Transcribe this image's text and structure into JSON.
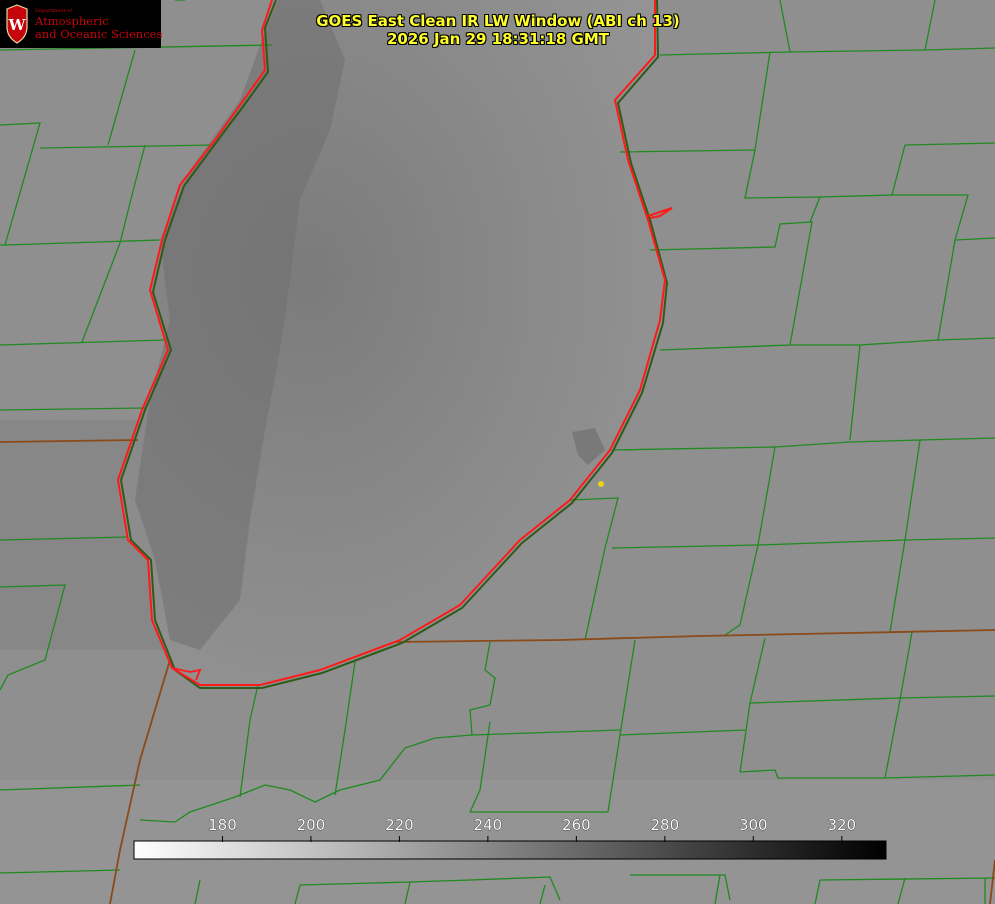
{
  "header": {
    "title": "GOES East Clean IR LW Window (ABI ch 13)",
    "timestamp": "2026 Jan 29 18:31:18 GMT"
  },
  "logo": {
    "crest_letter": "W",
    "department": "Department of",
    "line1": "Atmospheric",
    "line2": "and Oceanic Sciences"
  },
  "colorbar": {
    "min": 160,
    "max": 330,
    "ticks": [
      {
        "value": 180,
        "label": "180"
      },
      {
        "value": 200,
        "label": "200"
      },
      {
        "value": 220,
        "label": "220"
      },
      {
        "value": 240,
        "label": "240"
      },
      {
        "value": 260,
        "label": "260"
      },
      {
        "value": 280,
        "label": "280"
      },
      {
        "value": 300,
        "label": "300"
      },
      {
        "value": 320,
        "label": "320"
      }
    ],
    "color_low": "#ffffff",
    "color_high": "#000000"
  },
  "colors": {
    "background": "#8f8f8f",
    "lake_dark": "#6e6e6e",
    "county_lines": "#1f8a1f",
    "state_lines": "#8a4a1a",
    "shoreline": "#ff1a1a",
    "title_text": "#ffff2a",
    "marker": "#e6d21a"
  },
  "map": {
    "marker_icon": "location-dot-icon"
  }
}
